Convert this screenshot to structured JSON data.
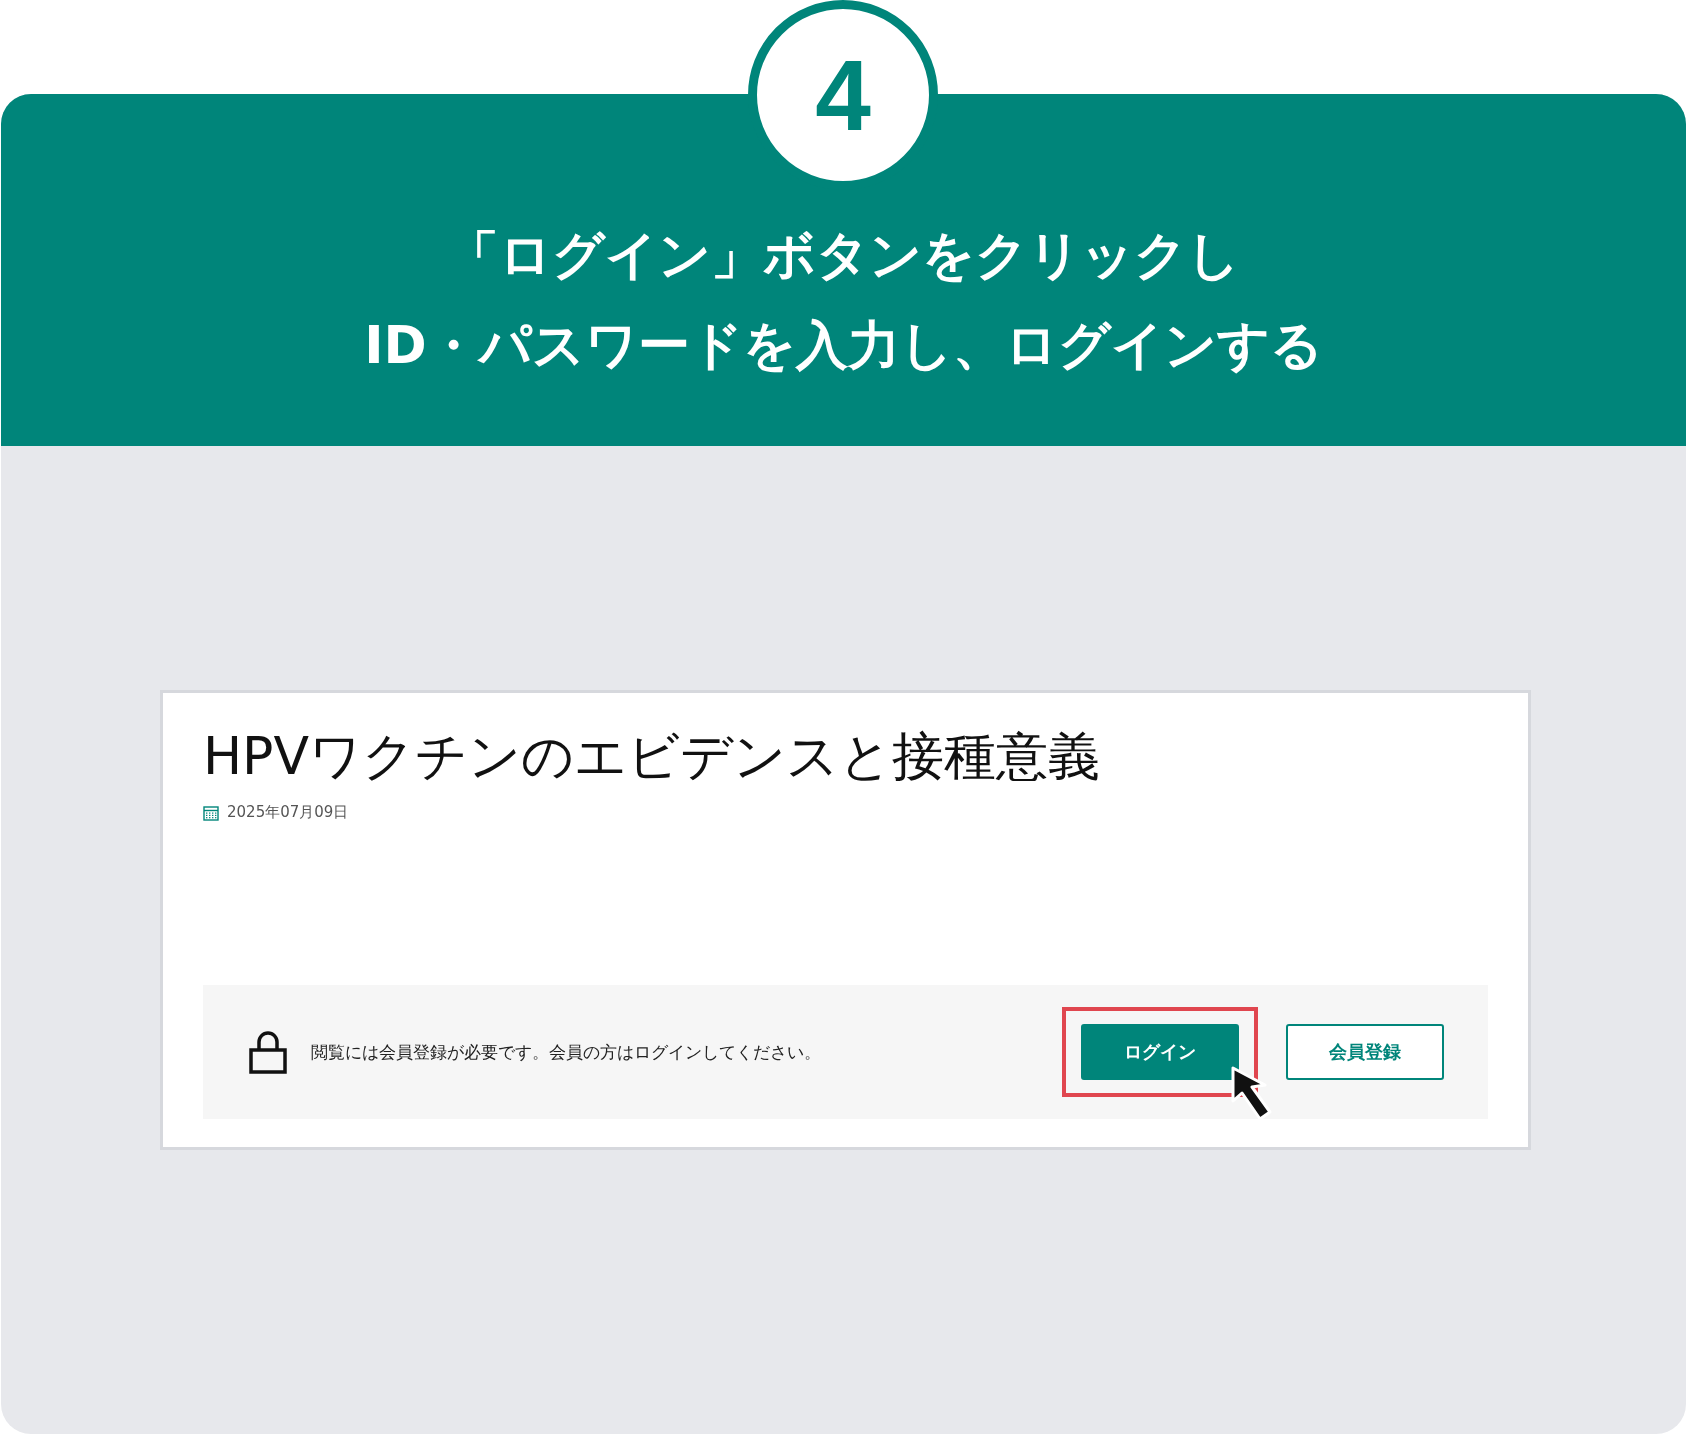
{
  "step": {
    "number": "4",
    "title_lines": [
      "「ログイン」ボタンをクリックし",
      "ID・パスワードを入力し、ログインする"
    ]
  },
  "article": {
    "title": "HPVワクチンのエビデンスと接種意義",
    "date": "2025年07月09日"
  },
  "login_notice": {
    "message": "閲覧には会員登録が必要です。会員の方はログインしてください。",
    "buttons": [
      {
        "label": "ログイン",
        "kind": "primary",
        "highlighted": true
      },
      {
        "label": "会員登録",
        "kind": "outline",
        "highlighted": false
      }
    ]
  }
}
